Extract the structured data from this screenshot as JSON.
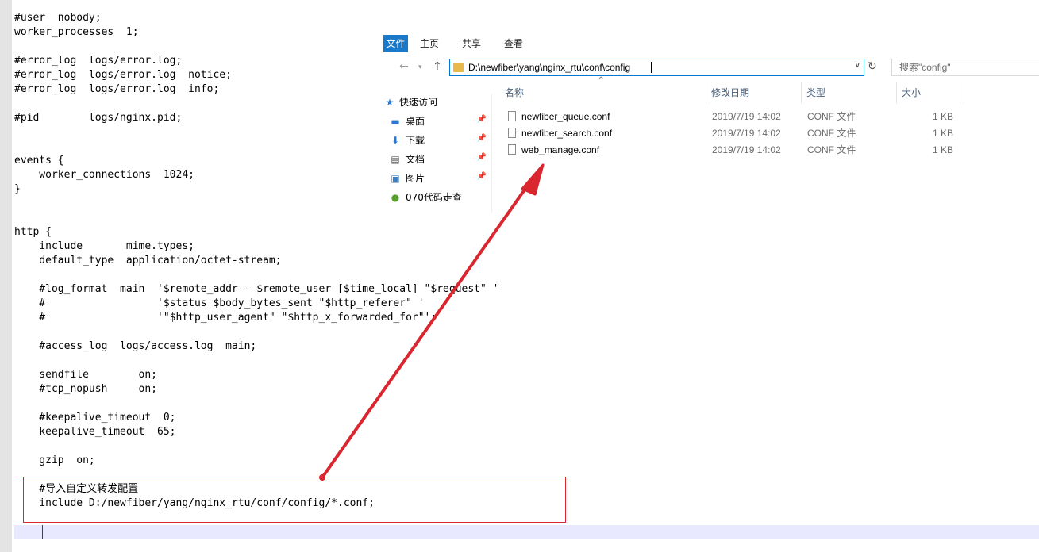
{
  "editor": {
    "lines": [
      "#user  nobody;",
      "worker_processes  1;",
      "",
      "#error_log  logs/error.log;",
      "#error_log  logs/error.log  notice;",
      "#error_log  logs/error.log  info;",
      "",
      "#pid        logs/nginx.pid;",
      "",
      "",
      "events {",
      "    worker_connections  1024;",
      "}",
      "",
      "",
      "http {",
      "    include       mime.types;",
      "    default_type  application/octet-stream;",
      "",
      "    #log_format  main  '$remote_addr - $remote_user [$time_local] \"$request\" '",
      "    #                  '$status $body_bytes_sent \"$http_referer\" '",
      "    #                  '\"$http_user_agent\" \"$http_x_forwarded_for\"';",
      "",
      "    #access_log  logs/access.log  main;",
      "",
      "    sendfile        on;",
      "    #tcp_nopush     on;",
      "",
      "    #keepalive_timeout  0;",
      "    keepalive_timeout  65;",
      "",
      "    gzip  on;",
      "",
      "    #导入自定义转发配置",
      "    include D:/newfiber/yang/nginx_rtu/conf/config/*.conf;"
    ]
  },
  "explorer": {
    "ribbon_tabs": [
      "文件",
      "主页",
      "共享",
      "查看"
    ],
    "address": "D:\\newfiber\\yang\\nginx_rtu\\conf\\config",
    "search_placeholder": "搜索\"config\"",
    "nav_items": [
      {
        "label": "快速访问",
        "icon": "star-icon",
        "pinned": false
      },
      {
        "label": "桌面",
        "icon": "desktop-icon",
        "pinned": true
      },
      {
        "label": "下载",
        "icon": "download-icon",
        "pinned": true
      },
      {
        "label": "文档",
        "icon": "document-icon",
        "pinned": true
      },
      {
        "label": "图片",
        "icon": "picture-icon",
        "pinned": true
      },
      {
        "label": "070代码走查",
        "icon": "folder-icon",
        "pinned": false
      }
    ],
    "columns": [
      "名称",
      "修改日期",
      "类型",
      "大小"
    ],
    "files": [
      {
        "name": "newfiber_queue.conf",
        "date": "2019/7/19 14:02",
        "type": "CONF 文件",
        "size": "1 KB"
      },
      {
        "name": "newfiber_search.conf",
        "date": "2019/7/19 14:02",
        "type": "CONF 文件",
        "size": "1 KB"
      },
      {
        "name": "web_manage.conf",
        "date": "2019/7/19 14:02",
        "type": "CONF 文件",
        "size": "1 KB"
      }
    ]
  },
  "colors": {
    "accent": "#1979ca",
    "annotation_red": "#d9262f",
    "current_line": "#e8e8ff"
  }
}
